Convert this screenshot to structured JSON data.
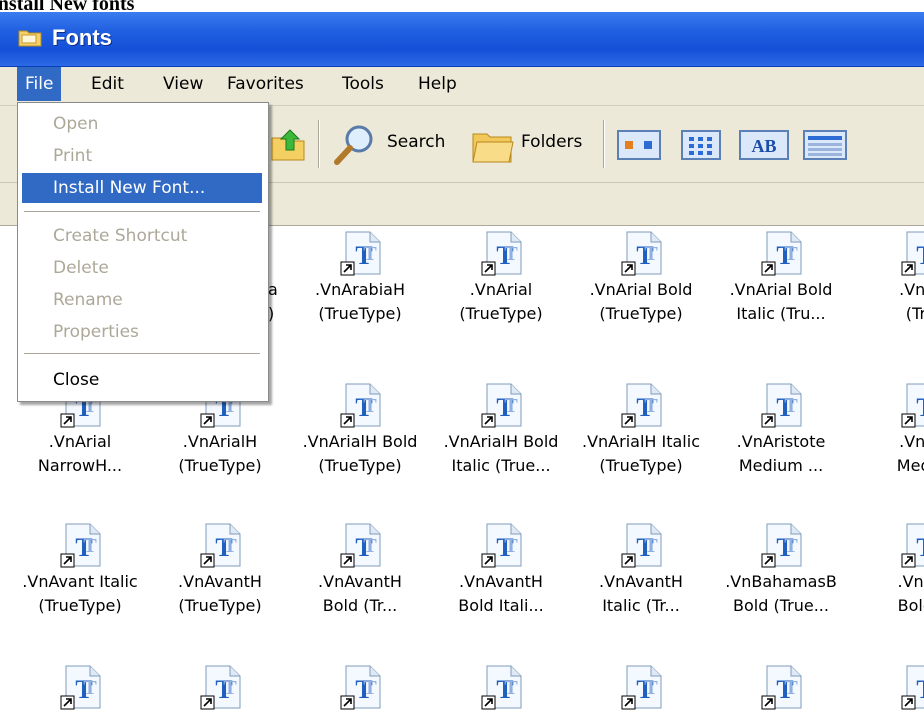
{
  "caption": "Install New fonts",
  "window": {
    "title": "Fonts"
  },
  "menubar": {
    "items": [
      "File",
      "Edit",
      "View",
      "Favorites",
      "Tools",
      "Help"
    ],
    "active": "File"
  },
  "toolbar": {
    "search_label": "Search",
    "folders_label": "Folders"
  },
  "file_menu": {
    "items": [
      {
        "label": "Open",
        "state": "disabled"
      },
      {
        "label": "Print",
        "state": "disabled"
      },
      {
        "label": "Install New Font...",
        "state": "highlighted"
      },
      {
        "label": "Create Shortcut",
        "state": "disabled"
      },
      {
        "label": "Delete",
        "state": "disabled"
      },
      {
        "label": "Rename",
        "state": "disabled"
      },
      {
        "label": "Properties",
        "state": "disabled"
      },
      {
        "label": "Close",
        "state": "enabled"
      }
    ]
  },
  "fonts": [
    [
      "",
      "",
      ".VnArabiaH\n(TrueType)",
      ".VnArial\n(TrueType)",
      ".VnArial Bold\n(TrueType)",
      ".VnArial Bold\nItalic (Tru...",
      ".VnAr\n(Tru"
    ],
    [
      ".VnArial\nNarrowH...",
      ".VnArialH\n(TrueType)",
      ".VnArialH Bold\n(TrueType)",
      ".VnArialH Bold\nItalic (True...",
      ".VnArialH Italic\n(TrueType)",
      ".VnAristote\nMedium ...",
      ".VnAr\nMediu"
    ],
    [
      ".VnAvant Italic\n(TrueType)",
      ".VnAvantH\n(TrueType)",
      ".VnAvantH\nBold (Tr...",
      ".VnAvantH\nBold Itali...",
      ".VnAvantH\nItalic (Tr...",
      ".VnBahamasB\nBold (True...",
      ".VnBa\nBold ("
    ],
    [
      "",
      "",
      "",
      "",
      "",
      "",
      ""
    ]
  ],
  "partial_labels": {
    "row1_col2_tail": "a\n)"
  },
  "colors": {
    "titlebar": "#1450d8",
    "menu_highlight": "#316ac5",
    "chrome": "#ece9d8",
    "disabled_text": "#aca899"
  }
}
